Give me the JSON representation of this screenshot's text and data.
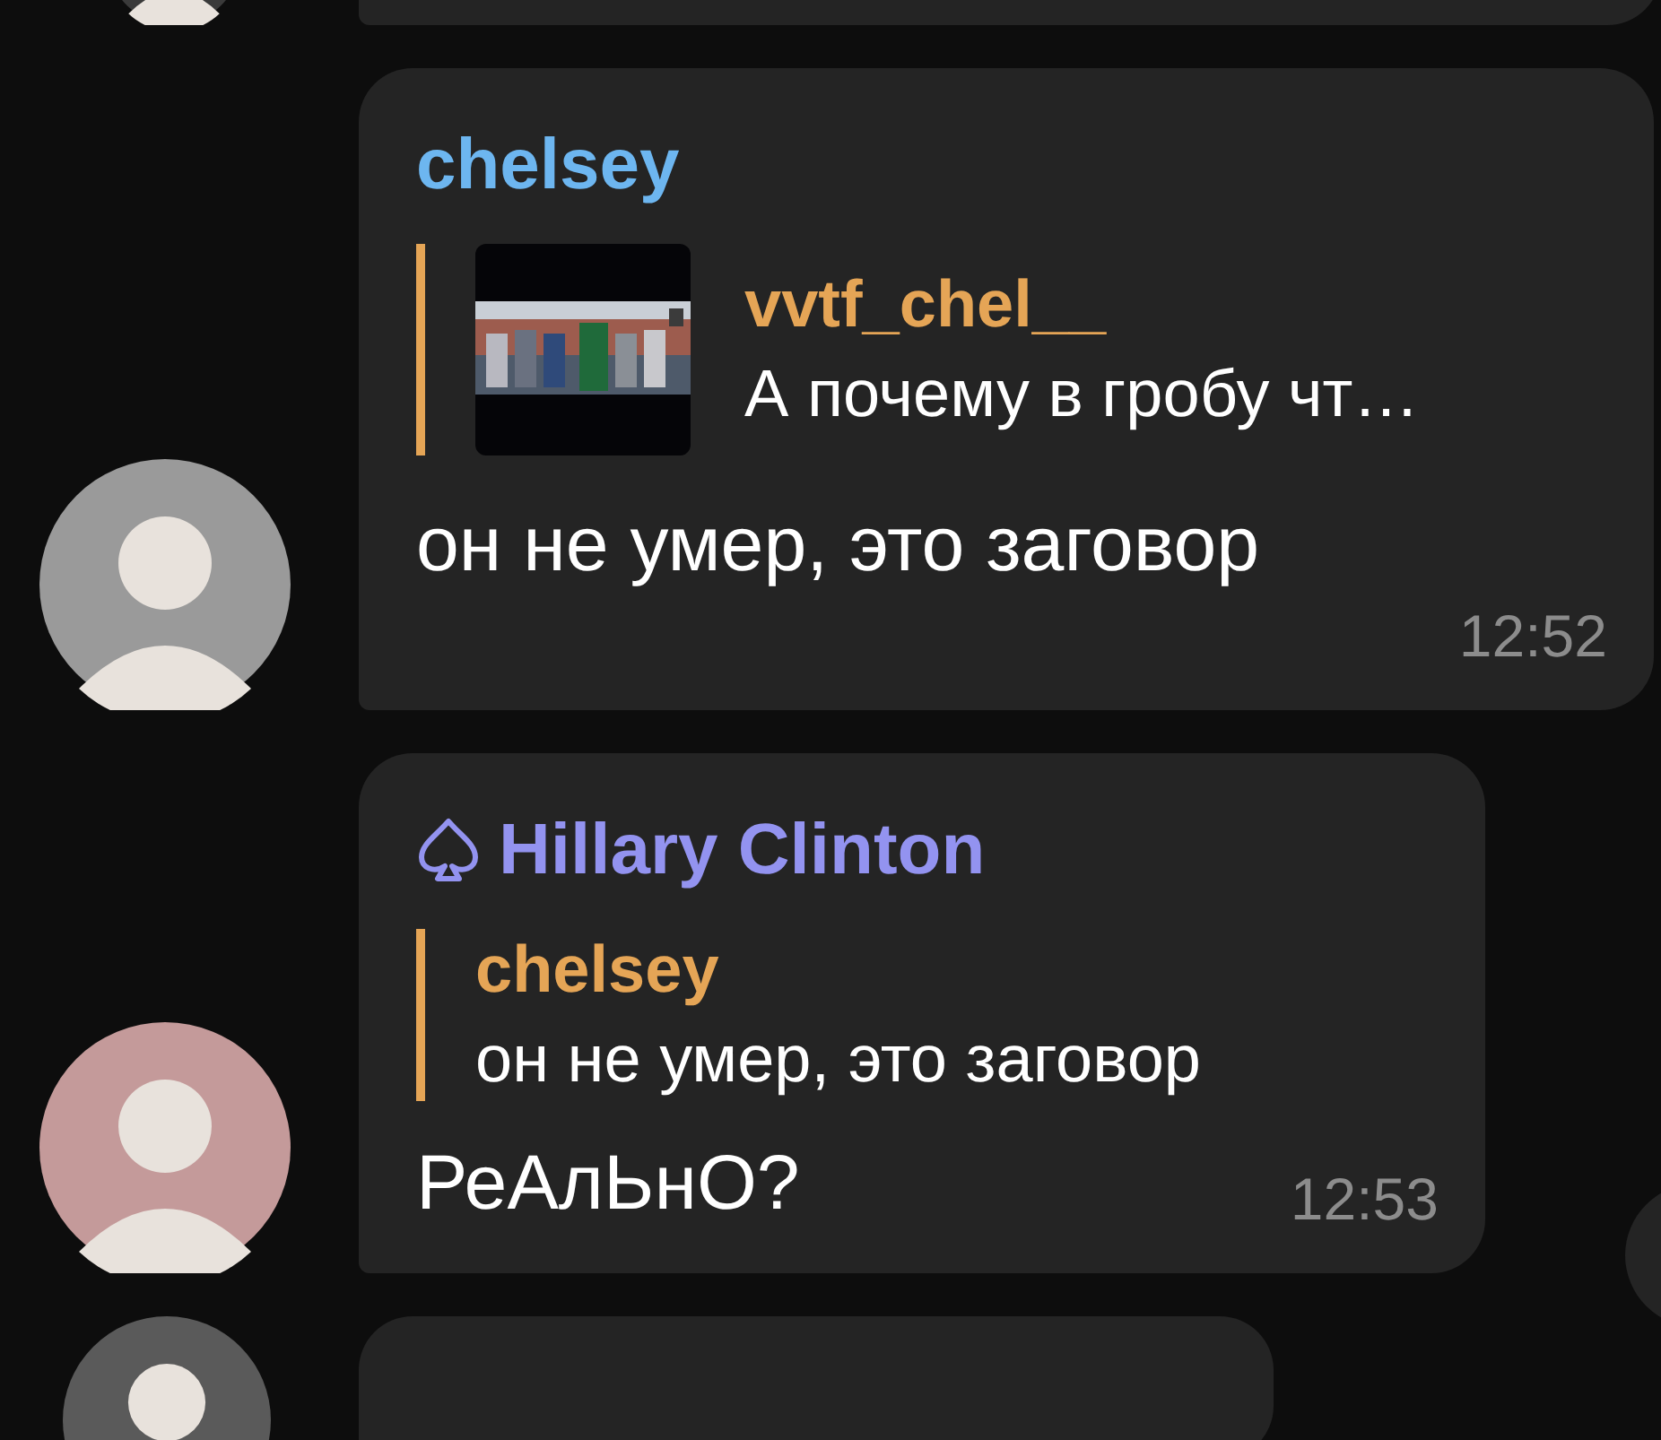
{
  "messages": [
    {
      "sender": "chelsey",
      "color": "#6db6f0",
      "spade": false,
      "reply": {
        "kind": "media",
        "author": "vvtf_chel__",
        "text": "А почему в гробу чт…"
      },
      "text": "он не умер, это заговор",
      "time": "12:52"
    },
    {
      "sender": "Hillary Clinton",
      "color": "#9393f0",
      "spade": true,
      "reply": {
        "kind": "text",
        "author": "chelsey",
        "text": "он не умер, это заговор"
      },
      "text": "РеАлЬнО?",
      "time": "12:53"
    }
  ]
}
